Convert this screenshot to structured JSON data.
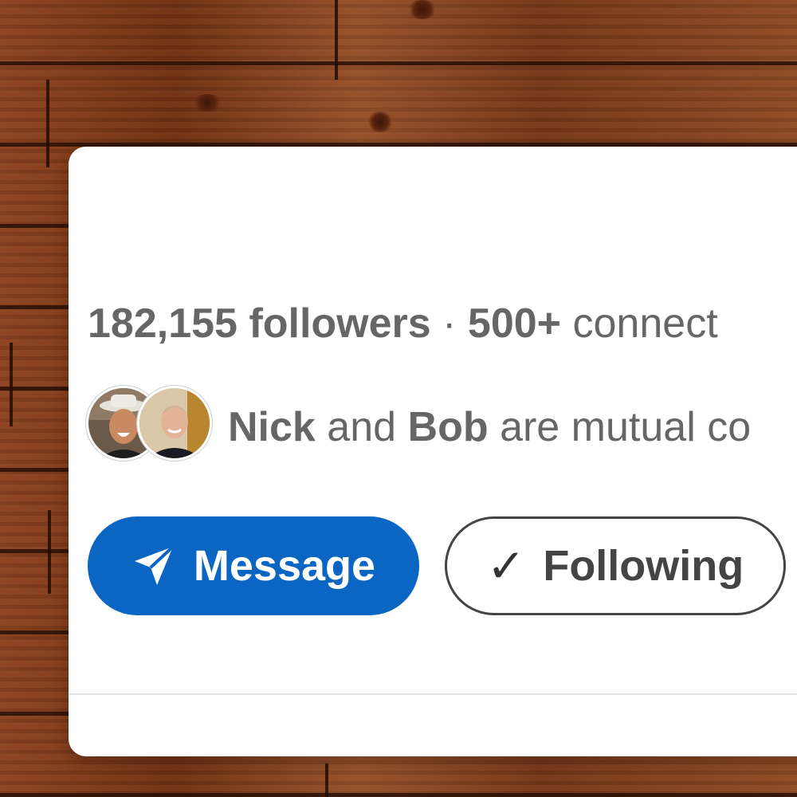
{
  "profile_card": {
    "followers_count": "182,155",
    "followers_label": "followers",
    "separator": "·",
    "connections_count": "500+",
    "connections_label": "connect",
    "mutual": {
      "names": [
        "Nick",
        "Bob"
      ],
      "conjunction": "and",
      "text_suffix": "are mutual co"
    },
    "actions": {
      "message_label": "Message",
      "message_icon": "paper-plane-icon",
      "following_label": "Following",
      "following_icon": "checkmark-icon",
      "following_check": "✓"
    }
  },
  "colors": {
    "primary": "#0a66c2",
    "text_gray": "#666666",
    "card_bg": "#ffffff",
    "background": "wood-brown"
  }
}
